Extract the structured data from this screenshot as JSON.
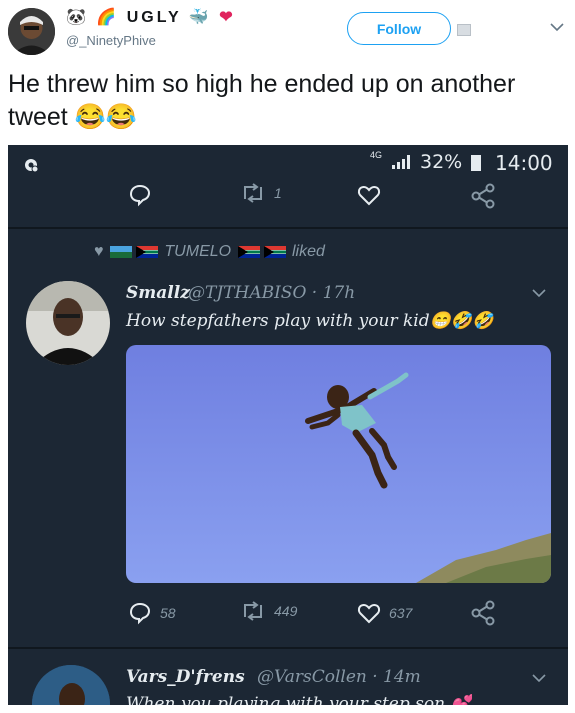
{
  "tweet": {
    "display_name": "UGLY",
    "username": "@_NinetyPhive",
    "follow_label": "Follow",
    "text": "He threw him so high he ended up on another tweet 😂😂"
  },
  "screenshot": {
    "status": {
      "network": "4G",
      "battery": "32%",
      "time": "14:00"
    },
    "top_actions": {
      "retweets": "1"
    },
    "liked_by": {
      "name": "TUMELO",
      "suffix": "liked"
    },
    "inner_tweet": {
      "name": "Smallz",
      "handle": "@TJTHABISO · 17h",
      "text": "How stepfathers play with your kid😁🤣🤣",
      "replies": "58",
      "retweets": "449",
      "likes": "637"
    },
    "next_tweet": {
      "name": "Vars_D'frens",
      "handle": "@VarsCollen · 14m",
      "text": "When you playing with your step son 💕"
    }
  },
  "colors": {
    "accent": "#1da1f2",
    "dark_bg": "#1c2734",
    "muted": "#8899a6"
  }
}
